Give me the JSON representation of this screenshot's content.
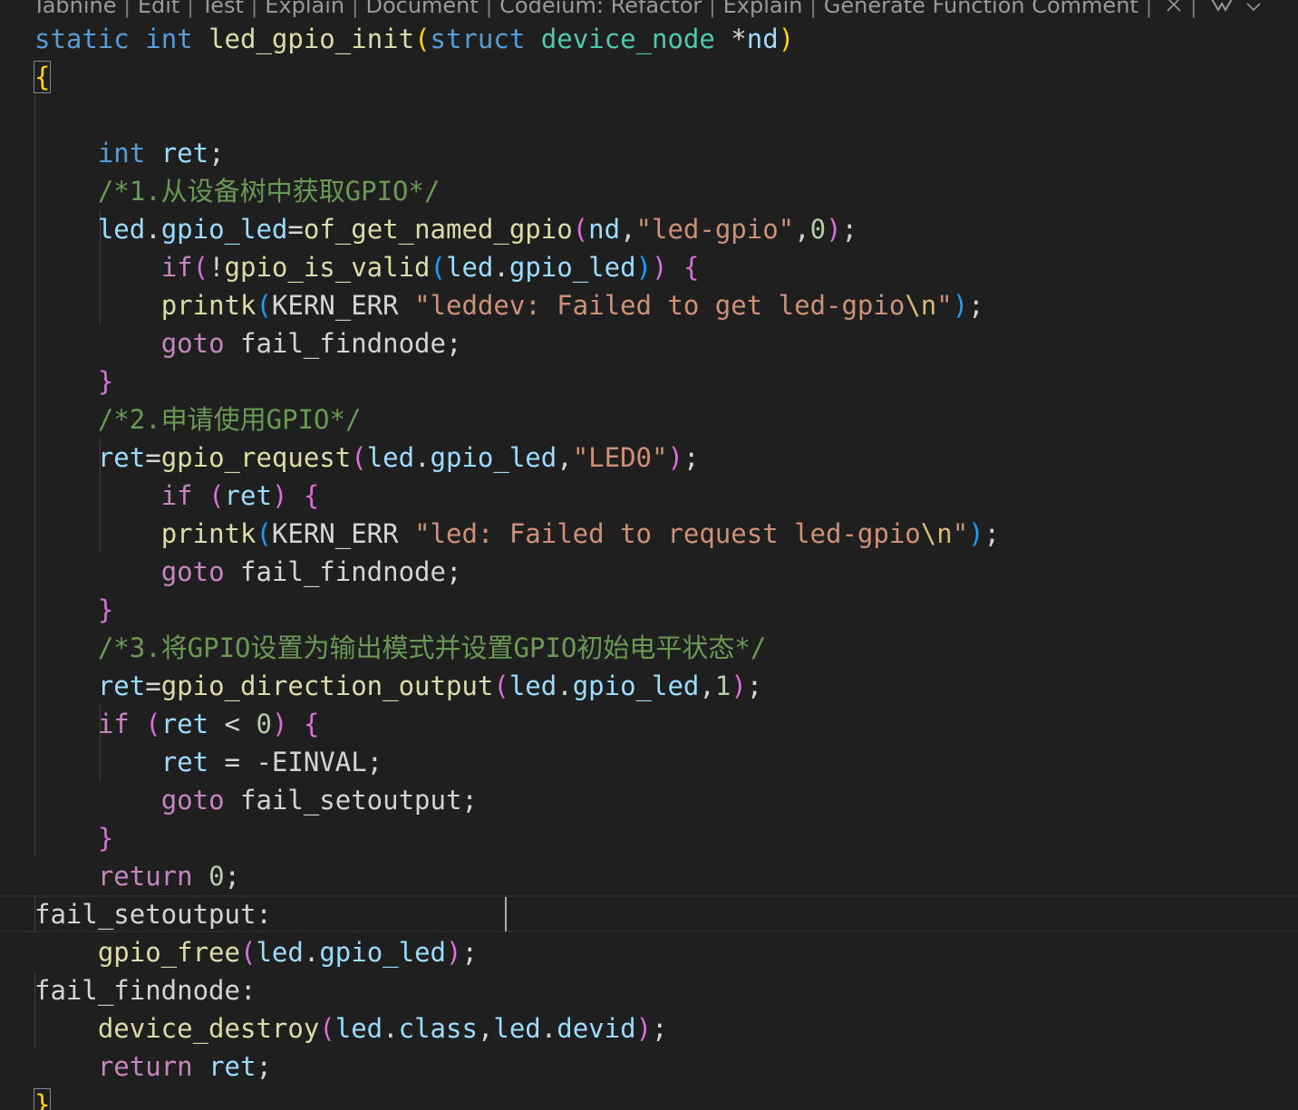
{
  "codelens": [
    "Tabnine",
    "Edit",
    "Test",
    "Explain",
    "Document",
    "Codeium: Refactor",
    "Explain",
    "Generate Function Comment"
  ],
  "codelens_separator": " | ",
  "codelens_icons": [
    "close-icon",
    "tabnine-logo-icon",
    "chevron-down-icon"
  ],
  "code": [
    [
      [
        "kw",
        "static"
      ],
      [
        "plain",
        " "
      ],
      [
        "kw",
        "int"
      ],
      [
        "plain",
        " "
      ],
      [
        "fn",
        "led_gpio_init"
      ],
      [
        "br1",
        "("
      ],
      [
        "kw",
        "struct"
      ],
      [
        "plain",
        " "
      ],
      [
        "typ",
        "device_node"
      ],
      [
        "plain",
        " *"
      ],
      [
        "var",
        "nd"
      ],
      [
        "br1",
        ")"
      ]
    ],
    [
      [
        "br1",
        "{"
      ]
    ],
    [],
    [
      [
        "plain",
        "    "
      ],
      [
        "kw",
        "int"
      ],
      [
        "plain",
        " "
      ],
      [
        "var",
        "ret"
      ],
      [
        "plain",
        ";"
      ]
    ],
    [
      [
        "plain",
        "    "
      ],
      [
        "cmt",
        "/*1.从设备树中获取GPIO*/"
      ]
    ],
    [
      [
        "plain",
        "    "
      ],
      [
        "var",
        "led"
      ],
      [
        "plain",
        "."
      ],
      [
        "var",
        "gpio_led"
      ],
      [
        "plain",
        "="
      ],
      [
        "fn",
        "of_get_named_gpio"
      ],
      [
        "br2",
        "("
      ],
      [
        "var",
        "nd"
      ],
      [
        "plain",
        ","
      ],
      [
        "str",
        "\"led-gpio\""
      ],
      [
        "plain",
        ","
      ],
      [
        "num",
        "0"
      ],
      [
        "br2",
        ")"
      ],
      [
        "plain",
        ";"
      ]
    ],
    [
      [
        "plain",
        "        "
      ],
      [
        "ctl",
        "if"
      ],
      [
        "br2",
        "("
      ],
      [
        "plain",
        "!"
      ],
      [
        "fn",
        "gpio_is_valid"
      ],
      [
        "br3",
        "("
      ],
      [
        "var",
        "led"
      ],
      [
        "plain",
        "."
      ],
      [
        "var",
        "gpio_led"
      ],
      [
        "br3",
        ")"
      ],
      [
        "br2",
        ")"
      ],
      [
        "plain",
        " "
      ],
      [
        "br2",
        "{"
      ]
    ],
    [
      [
        "plain",
        "        "
      ],
      [
        "fn",
        "printk"
      ],
      [
        "br3",
        "("
      ],
      [
        "plain",
        "KERN_ERR "
      ],
      [
        "str",
        "\"leddev: Failed to get led-gpio"
      ],
      [
        "esc",
        "\\n"
      ],
      [
        "str",
        "\""
      ],
      [
        "br3",
        ")"
      ],
      [
        "plain",
        ";"
      ]
    ],
    [
      [
        "plain",
        "        "
      ],
      [
        "ctl",
        "goto"
      ],
      [
        "plain",
        " fail_findnode;"
      ]
    ],
    [
      [
        "plain",
        "    "
      ],
      [
        "br2",
        "}"
      ]
    ],
    [
      [
        "plain",
        "    "
      ],
      [
        "cmt",
        "/*2.申请使用GPIO*/"
      ]
    ],
    [
      [
        "plain",
        "    "
      ],
      [
        "var",
        "ret"
      ],
      [
        "plain",
        "="
      ],
      [
        "fn",
        "gpio_request"
      ],
      [
        "br2",
        "("
      ],
      [
        "var",
        "led"
      ],
      [
        "plain",
        "."
      ],
      [
        "var",
        "gpio_led"
      ],
      [
        "plain",
        ","
      ],
      [
        "str",
        "\"LED0\""
      ],
      [
        "br2",
        ")"
      ],
      [
        "plain",
        ";"
      ]
    ],
    [
      [
        "plain",
        "        "
      ],
      [
        "ctl",
        "if"
      ],
      [
        "plain",
        " "
      ],
      [
        "br2",
        "("
      ],
      [
        "var",
        "ret"
      ],
      [
        "br2",
        ")"
      ],
      [
        "plain",
        " "
      ],
      [
        "br2",
        "{"
      ]
    ],
    [
      [
        "plain",
        "        "
      ],
      [
        "fn",
        "printk"
      ],
      [
        "br3",
        "("
      ],
      [
        "plain",
        "KERN_ERR "
      ],
      [
        "str",
        "\"led: Failed to request led-gpio"
      ],
      [
        "esc",
        "\\n"
      ],
      [
        "str",
        "\""
      ],
      [
        "br3",
        ")"
      ],
      [
        "plain",
        ";"
      ]
    ],
    [
      [
        "plain",
        "        "
      ],
      [
        "ctl",
        "goto"
      ],
      [
        "plain",
        " fail_findnode;"
      ]
    ],
    [
      [
        "plain",
        "    "
      ],
      [
        "br2",
        "}"
      ]
    ],
    [
      [
        "plain",
        "    "
      ],
      [
        "cmt",
        "/*3.将GPIO设置为输出模式并设置GPIO初始电平状态*/"
      ]
    ],
    [
      [
        "plain",
        "    "
      ],
      [
        "var",
        "ret"
      ],
      [
        "plain",
        "="
      ],
      [
        "fn",
        "gpio_direction_output"
      ],
      [
        "br2",
        "("
      ],
      [
        "var",
        "led"
      ],
      [
        "plain",
        "."
      ],
      [
        "var",
        "gpio_led"
      ],
      [
        "plain",
        ","
      ],
      [
        "num",
        "1"
      ],
      [
        "br2",
        ")"
      ],
      [
        "plain",
        ";"
      ]
    ],
    [
      [
        "plain",
        "    "
      ],
      [
        "ctl",
        "if"
      ],
      [
        "plain",
        " "
      ],
      [
        "br2",
        "("
      ],
      [
        "var",
        "ret"
      ],
      [
        "plain",
        " < "
      ],
      [
        "num",
        "0"
      ],
      [
        "br2",
        ")"
      ],
      [
        "plain",
        " "
      ],
      [
        "br2",
        "{"
      ]
    ],
    [
      [
        "plain",
        "        "
      ],
      [
        "var",
        "ret"
      ],
      [
        "plain",
        " = -EINVAL;"
      ]
    ],
    [
      [
        "plain",
        "        "
      ],
      [
        "ctl",
        "goto"
      ],
      [
        "plain",
        " fail_setoutput;"
      ]
    ],
    [
      [
        "plain",
        "    "
      ],
      [
        "br2",
        "}"
      ]
    ],
    [
      [
        "plain",
        "    "
      ],
      [
        "ctl",
        "return"
      ],
      [
        "plain",
        " "
      ],
      [
        "num",
        "0"
      ],
      [
        "plain",
        ";"
      ]
    ],
    [
      [
        "plain",
        "fail_setoutput:"
      ]
    ],
    [
      [
        "plain",
        "    "
      ],
      [
        "fn",
        "gpio_free"
      ],
      [
        "br2",
        "("
      ],
      [
        "var",
        "led"
      ],
      [
        "plain",
        "."
      ],
      [
        "var",
        "gpio_led"
      ],
      [
        "br2",
        ")"
      ],
      [
        "plain",
        ";"
      ]
    ],
    [
      [
        "plain",
        "fail_findnode:"
      ]
    ],
    [
      [
        "plain",
        "    "
      ],
      [
        "fn",
        "device_destroy"
      ],
      [
        "br2",
        "("
      ],
      [
        "var",
        "led"
      ],
      [
        "plain",
        "."
      ],
      [
        "var",
        "class"
      ],
      [
        "plain",
        ","
      ],
      [
        "var",
        "led"
      ],
      [
        "plain",
        "."
      ],
      [
        "var",
        "devid"
      ],
      [
        "br2",
        ")"
      ],
      [
        "plain",
        ";"
      ]
    ],
    [
      [
        "plain",
        "    "
      ],
      [
        "ctl",
        "return"
      ],
      [
        "plain",
        " "
      ],
      [
        "var",
        "ret"
      ],
      [
        "plain",
        ";"
      ]
    ],
    [
      [
        "br1",
        "}"
      ]
    ]
  ]
}
